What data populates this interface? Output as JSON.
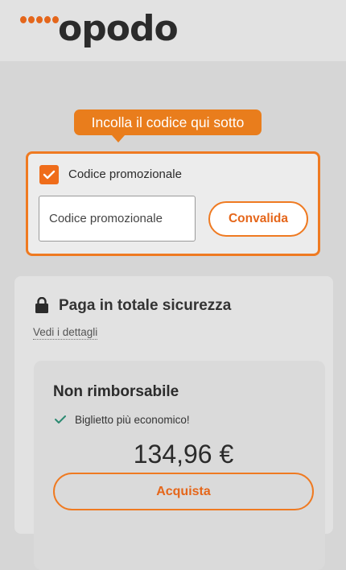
{
  "header": {
    "logo_text": "opodo"
  },
  "tooltip": {
    "text": "Incolla il codice qui sotto"
  },
  "promo": {
    "checkbox_checked": true,
    "label": "Codice promozionale",
    "input_placeholder": "Codice promozionale",
    "input_value": "",
    "validate_label": "Convalida"
  },
  "payment": {
    "title": "Paga in totale sicurezza",
    "details_link": "Vedi i dettagli",
    "fare": {
      "title": "Non rimborsabile",
      "feature": "Biglietto più economico!",
      "price": "134,96 €",
      "buy_label": "Acquista"
    }
  },
  "colors": {
    "brand_orange": "#ef7a21",
    "check_green": "#2c8a72"
  }
}
